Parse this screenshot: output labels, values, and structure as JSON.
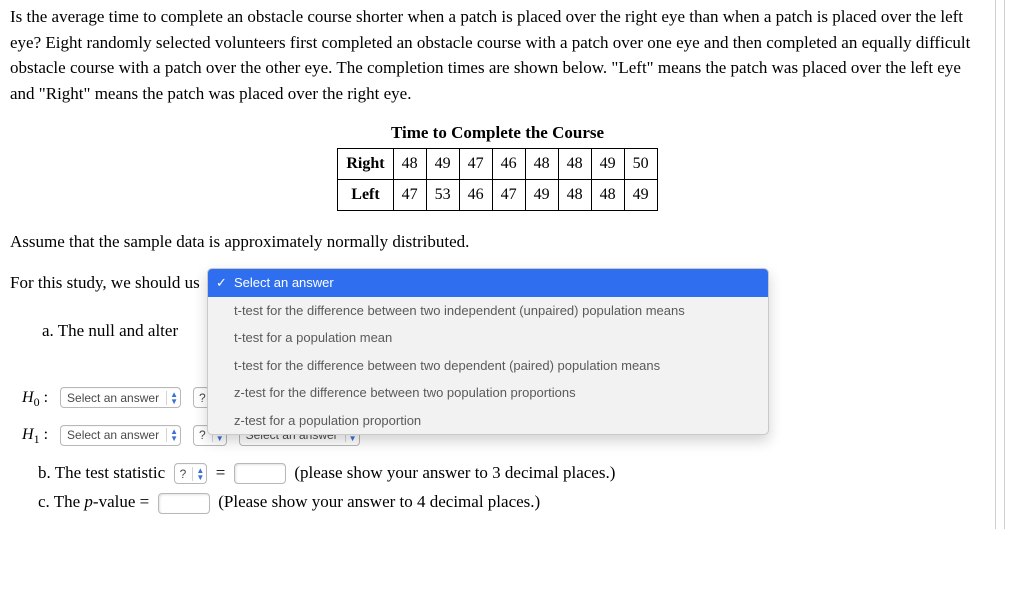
{
  "intro": "Is the average time to complete an obstacle course shorter when a patch is placed over the right eye than when a patch is placed over the left eye? Eight randomly selected volunteers first completed an obstacle course with a patch over one eye and then completed an equally difficult obstacle course with a patch over the other eye. The completion times are shown below. \"Left\" means the patch was placed over the left eye and \"Right\" means the patch was placed over the right eye.",
  "table_title": "Time to Complete the Course",
  "table": {
    "row1_label": "Right",
    "row1": [
      "48",
      "49",
      "47",
      "46",
      "48",
      "48",
      "49",
      "50"
    ],
    "row2_label": "Left",
    "row2": [
      "47",
      "53",
      "46",
      "47",
      "49",
      "48",
      "48",
      "49"
    ]
  },
  "assume": "Assume that the sample data is approximately normally distributed.",
  "study_prefix": "For this study, we should us",
  "dropdown": {
    "selected": "Select an answer",
    "options": [
      "t-test for the difference between two independent (unpaired) population means",
      "t-test for a population mean",
      "t-test for the difference between two dependent (paired) population means",
      "z-test for the difference between two population proportions",
      "z-test for a population proportion"
    ]
  },
  "part_a_behind": "a.  The null and alter",
  "H0_label": "H",
  "H0_sub": "0",
  "H1_sub": "1",
  "colon": ":",
  "select_placeholder": "Select an answer",
  "qmark": "?",
  "part_b_prefix": "b.  The test statistic",
  "equals": "=",
  "part_b_suffix": "(please show your answer to 3 decimal places.)",
  "part_c_prefix_1": "c.  The ",
  "part_c_pvalue": "p",
  "part_c_prefix_2": "-value =",
  "part_c_suffix": "(Please show your answer to 4 decimal places.)",
  "chart_data": {
    "type": "table",
    "title": "Time to Complete the Course",
    "columns": [
      "V1",
      "V2",
      "V3",
      "V4",
      "V5",
      "V6",
      "V7",
      "V8"
    ],
    "series": [
      {
        "name": "Right",
        "values": [
          48,
          49,
          47,
          46,
          48,
          48,
          49,
          50
        ]
      },
      {
        "name": "Left",
        "values": [
          47,
          53,
          46,
          47,
          49,
          48,
          48,
          49
        ]
      }
    ]
  }
}
